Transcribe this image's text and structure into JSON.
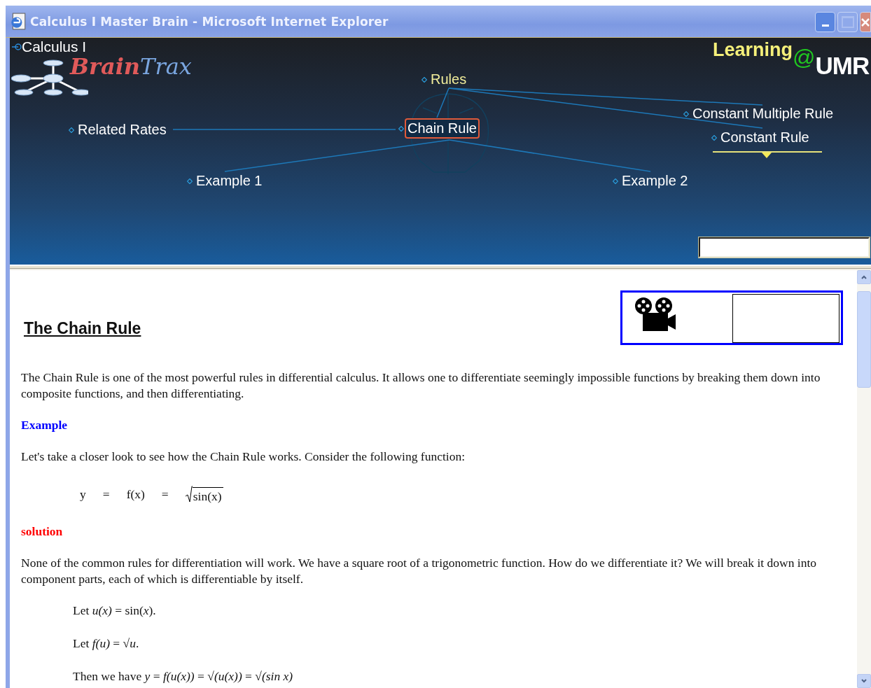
{
  "window": {
    "title": "Calculus I Master Brain - Microsoft Internet Explorer"
  },
  "mind_map": {
    "root": "Calculus I",
    "logo": {
      "brain": "Brain",
      "trax": "Trax"
    },
    "badge": {
      "learning": "Learning",
      "at": "@",
      "site": "UMR"
    },
    "nodes": [
      {
        "label": "Rules",
        "color": "#f0ec9a",
        "selected": false,
        "focused": false
      },
      {
        "label": "Related Rates",
        "color": "#ffffff",
        "selected": false,
        "focused": false
      },
      {
        "label": "Chain Rule",
        "color": "#ffffff",
        "selected": true,
        "focused": false
      },
      {
        "label": "Constant Multiple Rule",
        "color": "#ffffff",
        "selected": false,
        "focused": false
      },
      {
        "label": "Constant Rule",
        "color": "#ffffff",
        "selected": false,
        "focused": true
      },
      {
        "label": "Example 1",
        "color": "#ffffff",
        "selected": false,
        "focused": false
      },
      {
        "label": "Example 2",
        "color": "#ffffff",
        "selected": false,
        "focused": false
      }
    ]
  },
  "content": {
    "heading": "The Chain Rule",
    "blocks": [
      {
        "kind": "paragraph",
        "text": "The Chain Rule is one of the most powerful rules in differential calculus.  It allows one to differentiate seemingly impossible functions by breaking them down into composite functions, and then differentiating."
      },
      {
        "kind": "label",
        "text": "Example",
        "color": "#0000ff"
      },
      {
        "kind": "paragraph",
        "text": "Let's take a closer look to see how the Chain Rule works.  Consider the following function:"
      },
      {
        "kind": "equation",
        "parts": [
          "y",
          "=",
          "f(x)",
          "="
        ],
        "root": "sin(x)"
      },
      {
        "kind": "label",
        "text": "solution",
        "color": "#ff0000"
      },
      {
        "kind": "paragraph",
        "text": "None of the common rules for differentiation will work.  We have a square root of a trigonometric function.  How do we differentiate it?  We will break it down into component parts, each of which is differentiable by itself."
      },
      {
        "kind": "step",
        "text": "Let *u(x)* = sin(*x*)."
      },
      {
        "kind": "step",
        "text": "Let *f(u)* = √*u*."
      },
      {
        "kind": "step",
        "text": "Then we have *y* = *f(u(x))* = √*(u(x))* = √*(sin x)*"
      }
    ]
  }
}
